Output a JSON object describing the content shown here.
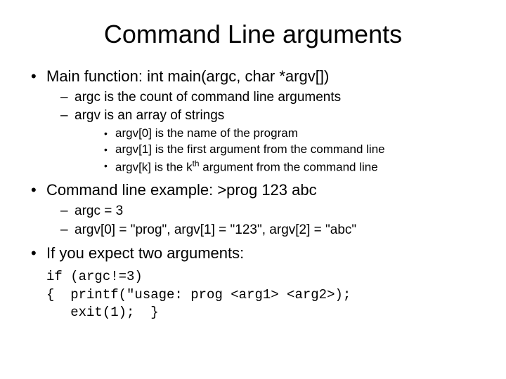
{
  "title": "Command Line arguments",
  "bullets": {
    "main": "Main function: int main(argc, char *argv[])",
    "argc_desc": "argc is the count of command line arguments",
    "argv_desc": "argv is an array of strings",
    "argv0": "argv[0] is the name of the program",
    "argv1": "argv[1] is the first argument from the command line",
    "argvk_pre": "argv[k] is the k",
    "argvk_sup": "th",
    "argvk_post": " argument from the command line",
    "example": "Command line example: >prog 123 abc",
    "argc_val": "argc = 3",
    "argv_vals": "argv[0] = \"prog\", argv[1] = \"123\", argv[2] = \"abc\"",
    "expect": "If you expect two arguments:",
    "code": "if (argc!=3)\n{  printf(\"usage: prog <arg1> <arg2>);\n   exit(1);  }"
  }
}
